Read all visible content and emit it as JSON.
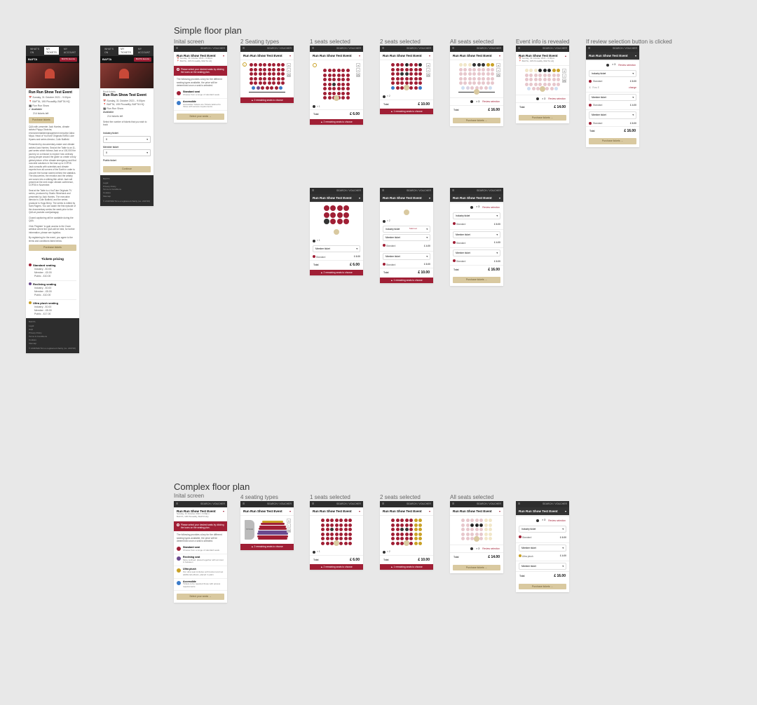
{
  "sections": {
    "simple": "Simple floor plan",
    "complex": "Complex floor plan"
  },
  "columns": {
    "initial": "Inital screen",
    "two_types": "2 Seating types",
    "four_types": "4 seating types",
    "one_sel": "1 seats selected",
    "two_sel": "2 seats selected",
    "all_sel": "All seats selected",
    "info_rev": "Event info is revealed",
    "review_click": "If review selection button is clicked"
  },
  "nav": {
    "whats_on": "WHAT'S ON",
    "my_tickets": "MY TICKETS",
    "my_account": "MY ACCOUNT",
    "search": "SEARCH / VOUCHER"
  },
  "brand": {
    "bafta": "BAFTA",
    "events_btn": "BAFTA Events"
  },
  "event": {
    "title": "Run Run Show Test Event",
    "date": "Sunday, 31 October 2021 - 9:00pm",
    "venue": "BAFTA, 195 Piccadilly, BAFTA HQ",
    "series": "Run Run Show",
    "avail": "Available",
    "avail_sub": "214 tickets left",
    "buy": "Purchase tickets",
    "date_short": "Sunday, 31 October 2021 • 9:00pm",
    "venue_short": "BAFTA, 195 Piccadilly, BAFTA HQ"
  },
  "body_text": {
    "p1": "Q&A with presenter Jack Harries, climate activist Poppy Okotcha, environmentalist/management executive Akira Miyai, Head of YouTube Originals EMEA Luke Hyams and series director, Colin Butfield.",
    "p2": "Presented by documentary-maker and climate activist Jack Harries. Seat at the Table is an 11-part series which follows Jack on a 100,000 Km journey on a mission to explore how ordinary young people around the globe co create a truly global picture of the climate emergency and find concrete solutions in the lead up to COP26. Jack consults with scientists and climate experts from all corners of the Earth in order to uncover the human stories behind the statistics. The discoveries, the emotion and the artistry are woven into a striking film which Jack will present at the next major climate conference, COP26 in November.",
    "p3": "Seat at the Table is a YouTube Originals TV series, produced by Studio Silverback and presented by Jack Harries. The executive director is Colin Butfield, and the series producer is Hugo Berry. The series is edited by Sam Rogers. You can watch the first episode of the documentary series the week prior to the Q&A at youtube.com/jacksgap",
    "p4": "Closed captioning will be available during the Q&A.",
    "p5": "Click 'Register' to gain access to the Zoom webinar where the Q&A will be held, for further information, please see logistics.",
    "p6": "By registering for the event, you agree to the terms and conditions listed below."
  },
  "pricing": {
    "header": "Tickets pricing",
    "standard": "Standard seating",
    "reclining": "Reclining seating",
    "ultra": "Ultra plush seating",
    "industry": "Industry - £0.00",
    "member_5": "Member - £5.00",
    "member_0": "Member - £0.00",
    "public_10": "Public - £10.00",
    "public_17": "Public - £17.00",
    "industry_0": "Industry - £0.00"
  },
  "footer": {
    "crest": "BAFTA",
    "links": [
      "Legal",
      " Help",
      "Privacy Policy",
      "Terms & Conditions",
      "Cookies",
      "Sitemap"
    ],
    "copy": "© 2018 BAFTA is a registered charity (no. 216726)"
  },
  "booking": {
    "book_label": "Book tickets",
    "intro": "Select the number of tickets that you wish to book",
    "industry_ticket": "Industry ticket",
    "member_ticket": "Member ticket",
    "public_ticket": "Public ticket",
    "continue": "Continue"
  },
  "floor": {
    "alert": "Please select your desired seats by clicking the icons on the seating plan.",
    "key_intro": "The following provides a key for the different seating types available, the price will be determined once a seat is selected.",
    "standard": "Standard seat",
    "standard_desc": "Choose from a range of standard seats",
    "reclining": "Reclining seat",
    "reclining_desc": "More reclined, placed together with armrest in between",
    "ultra": "Ultra plush",
    "ultra_desc": "Our ultra seat includes soft footrest and set additional pillows, placed in pairs",
    "accessible": "Accessible",
    "accessible_desc": "Tickets to be required those with access requirements",
    "accessible_desc2": "Accessible Tickets are Tickets tailored to those with access requirements",
    "select_seats": "Select your seats",
    "remaining_2": "2 remaining seats to choose",
    "remaining_1": "1 remaining seats to choose",
    "total": "Total",
    "p6": "£ 6.00",
    "p10": "£ 10.00",
    "p16": "£ 16.00",
    "p14": "£ 14.00",
    "review": "Review selection",
    "purchase": "Purchase tickets",
    "industry_t": "Industry ticket",
    "member_t": "Member ticket",
    "sold_out": "Sold out",
    "row_e": "Row E",
    "seat_type_std": "Standard",
    "seat_type_ultra": "Ultra plush",
    "price_0": "£ 0.00",
    "price_6": "£ 6.00",
    "price_4": "£ 4.00",
    "price_10": "£ 10.00",
    "seats_badge": "3",
    "change": "change",
    "seat_e": "E"
  }
}
